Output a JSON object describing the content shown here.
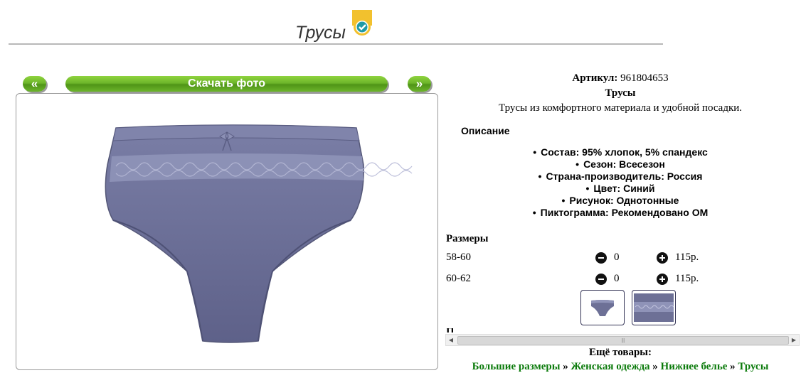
{
  "header": {
    "title": "Трусы"
  },
  "nav": {
    "prev_label": "«",
    "download_label": "Скачать фото",
    "next_label": "»"
  },
  "product": {
    "article_label": "Артикул:",
    "article_value": "961804653",
    "name": "Трусы",
    "subtitle": "Трусы из комфортного материала и удобной посадки."
  },
  "description": {
    "heading": "Описание",
    "items": [
      "Состав: 95% хлопок, 5% спандекс",
      "Сезон: Всесезон",
      "Страна-производитель: Россия",
      "Цвет: Синий",
      "Рисунок: Однотонные",
      "Пиктограмма: Рекомендовано ОМ"
    ]
  },
  "sizes": {
    "heading": "Размеры",
    "rows": [
      {
        "label": "58-60",
        "qty": "0",
        "price": "115р."
      },
      {
        "label": "60-62",
        "qty": "0",
        "price": "115р."
      }
    ]
  },
  "more": {
    "heading": "Ещё товары:",
    "crumbs": [
      "Большие размеры",
      "Женская одежда",
      "Нижнее белье",
      "Трусы"
    ],
    "separator": "»"
  },
  "colors": {
    "accent_green": "#6db62a",
    "link_green": "#0a7a0a",
    "garment": "#6d7096"
  }
}
